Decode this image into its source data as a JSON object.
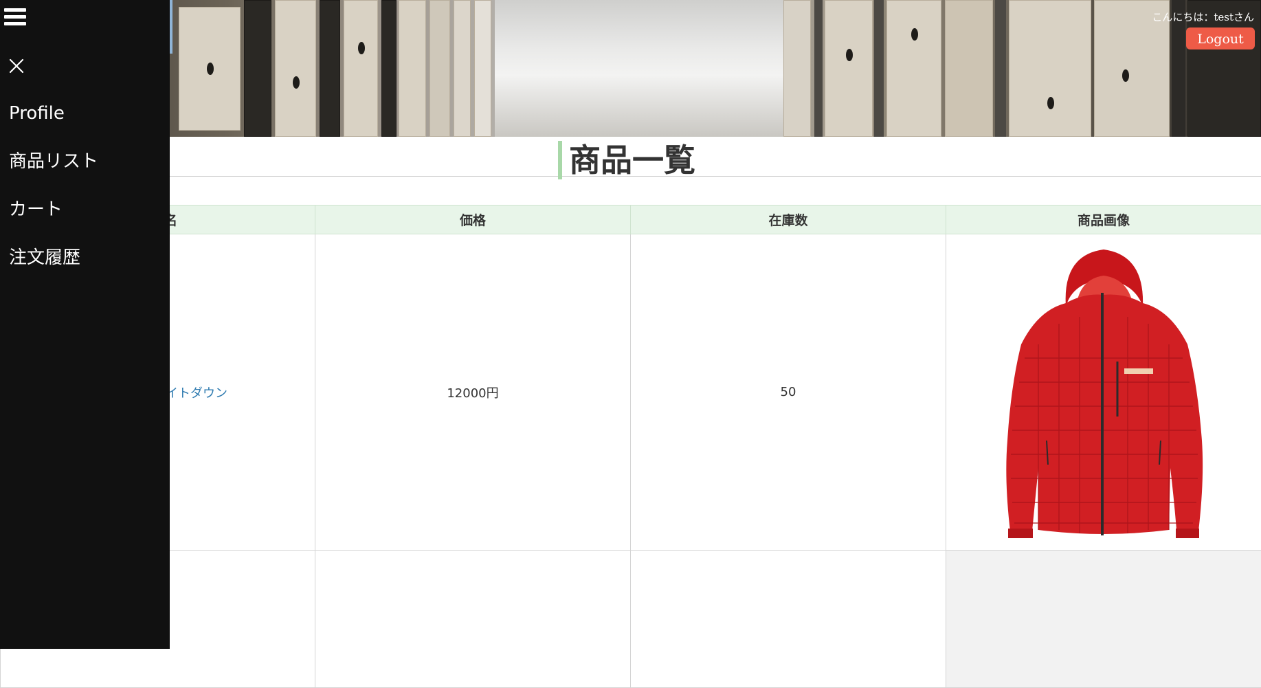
{
  "header": {
    "greeting": "こんにちは：testさん",
    "logout_label": "Logout"
  },
  "page_title": "商品一覧",
  "table": {
    "headers": [
      "名",
      "価格",
      "在庫数",
      "商品画像"
    ],
    "rows": [
      {
        "name": "イトダウン",
        "price": "12000円",
        "stock": "50",
        "image": "red-down-jacket"
      }
    ]
  },
  "drawer": {
    "items": [
      "Profile",
      "商品リスト",
      "カート",
      "注文履歴"
    ]
  },
  "colors": {
    "drawer_bg": "#111111",
    "logout_bg": "#ee5b47",
    "header_row_bg": "#e8f5e9",
    "title_accent": "#a8d8a8",
    "link": "#2f7bb0"
  }
}
